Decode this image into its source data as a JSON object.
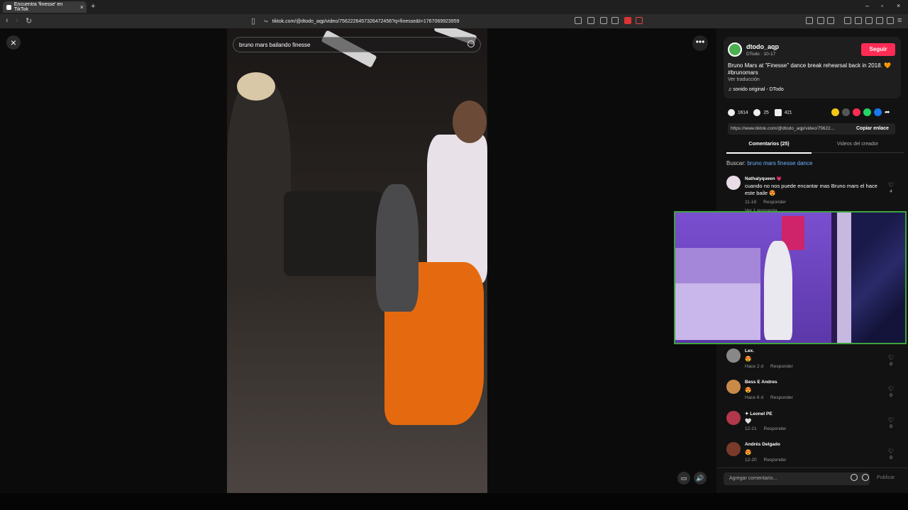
{
  "browser": {
    "tab_title": "Encuentra 'finesse' en TikTok",
    "new_tab_icon": "plus-icon",
    "url": "tiktok.com/@dtodo_aqp/video/7562226457326472456?q=finesse&t=1767069923959"
  },
  "player": {
    "search_text": "bruno mars bailando finesse"
  },
  "post": {
    "username": "dtodo_aqp",
    "subline": "DTodo · 10-17",
    "follow_label": "Seguir",
    "description": "Bruno Mars at \"Finesse\" dance break rehearsal back in 2018. 🧡 #brunomars",
    "translation_label": "Ver traducción",
    "sound": "sonido original - DTodo",
    "likes": "1614",
    "comments": "25",
    "saves": "421",
    "link": "https://www.tiktok.com/@dtodo_aqp/video/75622...",
    "copy_label": "Copiar enlace",
    "share_colors": [
      "#f5c518",
      "#555555",
      "#fe2c55",
      "#25d366",
      "#1877f2"
    ]
  },
  "tabs": {
    "comments_tab": "Comentarios (25)",
    "creator_tab": "Videos del creador"
  },
  "search_suggest": {
    "prefix": "Buscar:",
    "query": "bruno mars finesse dance"
  },
  "comments": [
    {
      "name": "Nathalyqueen 💗",
      "text": "cuando no nos puede encantar mas Bruno mars el hace este baile 😍",
      "date": "11-18",
      "reply": "Responder",
      "likes": "4",
      "extra": "Ver 1 respuesta"
    },
    {
      "name": "Lex.",
      "text": "😍",
      "date": "Hace 2 d",
      "reply": "Responder",
      "likes": "0"
    },
    {
      "name": "Bess E Andres",
      "text": "😍",
      "date": "Hace 6 d",
      "reply": "Responder",
      "likes": "0"
    },
    {
      "name": "✦ Leonel PE",
      "text": "🤍",
      "date": "12-21",
      "reply": "Responder",
      "likes": "0"
    },
    {
      "name": "Andrés Delgado",
      "text": "😍",
      "date": "12-20",
      "reply": "Responder",
      "likes": "0"
    }
  ],
  "composer": {
    "placeholder": "Agregar comentario...",
    "publish_label": "Publicar"
  }
}
